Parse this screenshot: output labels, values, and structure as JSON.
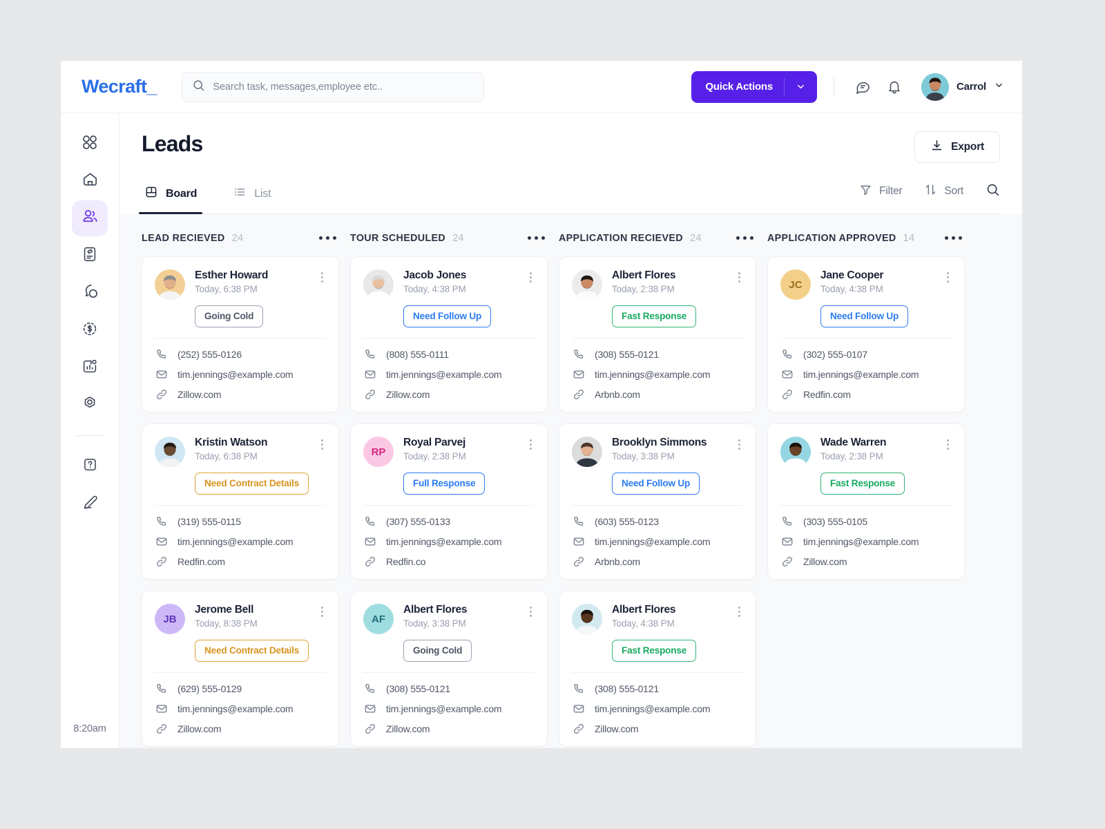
{
  "header": {
    "logo": "Wecraft",
    "logo_tail": "_",
    "search": {
      "placeholder": "Search task, messages,employee etc.."
    },
    "quick_actions_label": "Quick Actions",
    "user_name": "Carrol",
    "accent_color": "#5720e8"
  },
  "sidebar": {
    "items": [
      {
        "name": "grid-icon"
      },
      {
        "name": "home-icon"
      },
      {
        "name": "people-icon"
      },
      {
        "name": "document-icon"
      },
      {
        "name": "chat-icon"
      },
      {
        "name": "dollar-icon"
      },
      {
        "name": "analytics-icon"
      },
      {
        "name": "target-icon"
      },
      {
        "name": "help-icon"
      },
      {
        "name": "edit-icon"
      }
    ],
    "clock": "8:20am"
  },
  "page": {
    "title": "Leads",
    "export_label": "Export",
    "tabs": [
      {
        "label": "Board",
        "active": true
      },
      {
        "label": "List",
        "active": false
      }
    ],
    "tools": [
      {
        "label": "Filter"
      },
      {
        "label": "Sort"
      },
      {
        "label": ""
      }
    ]
  },
  "badge_styles": {
    "Going Cold": {
      "color": "#4f5665",
      "border": "#9aa2b1"
    },
    "Need Follow Up": {
      "color": "#2b7cf0",
      "border": "#2b7cf0"
    },
    "Full Response": {
      "color": "#2b7cf0",
      "border": "#2b7cf0"
    },
    "Need Contract Details": {
      "color": "#d99420",
      "border": "#e0a336"
    },
    "Fast Response": {
      "color": "#17a963",
      "border": "#2eb472"
    }
  },
  "columns": [
    {
      "title": "LEAD RECIEVED",
      "count": "24",
      "cards": [
        {
          "name": "Esther Howard",
          "time": "Today, 6:38 PM",
          "badge": "Going Cold",
          "phone": "(252) 555-0126",
          "email": "tim.jennings@example.com",
          "site": "Zillow.com",
          "avatar": {
            "type": "photo",
            "bg": "#f3cf96",
            "skin": "#e0b08a",
            "hair": "#8d8d8d",
            "shirt": "#f4f4f4"
          }
        },
        {
          "name": "Kristin Watson",
          "time": "Today, 6:38 PM",
          "badge": "Need Contract Details",
          "phone": "(319) 555-0115",
          "email": "tim.jennings@example.com",
          "site": "Redfin.com",
          "avatar": {
            "type": "photo",
            "bg": "#cfe7f2",
            "skin": "#6b4a33",
            "hair": "#241a14",
            "shirt": "#f0f2f4"
          }
        },
        {
          "name": "Jerome Bell",
          "time": "Today, 8:38 PM",
          "badge": "Need Contract Details",
          "phone": "(629) 555-0129",
          "email": "tim.jennings@example.com",
          "site": "Zillow.com",
          "avatar": {
            "type": "initials",
            "initials": "JB",
            "bg": "#cdb8f7",
            "fg": "#5e36b8"
          }
        }
      ]
    },
    {
      "title": "TOUR SCHEDULED",
      "count": "24",
      "cards": [
        {
          "name": "Jacob Jones",
          "time": "Today, 4:38 PM",
          "badge": "Need Follow Up",
          "phone": "(808) 555-0111",
          "email": "tim.jennings@example.com",
          "site": "Zillow.com",
          "avatar": {
            "type": "photo",
            "bg": "#e8e8e8",
            "skin": "#e8c1a2",
            "hair": "#d8d8d8",
            "shirt": "#ffffff"
          }
        },
        {
          "name": "Royal Parvej",
          "time": "Today, 2:38 PM",
          "badge": "Full Response",
          "phone": "(307) 555-0133",
          "email": "tim.jennings@example.com",
          "site": "Redfin.co",
          "avatar": {
            "type": "initials",
            "initials": "RP",
            "bg": "#fbc8e4",
            "fg": "#d6277f"
          }
        },
        {
          "name": "Albert Flores",
          "time": "Today, 3:38 PM",
          "badge": "Going Cold",
          "phone": "(308) 555-0121",
          "email": "tim.jennings@example.com",
          "site": "Zillow.com",
          "avatar": {
            "type": "initials",
            "initials": "AF",
            "bg": "#9fdde0",
            "fg": "#1f6f79"
          }
        }
      ]
    },
    {
      "title": "APPLICATION RECIEVED",
      "count": "24",
      "cards": [
        {
          "name": "Albert Flores",
          "time": "Today, 2:38 PM",
          "badge": "Fast Response",
          "phone": "(308) 555-0121",
          "email": "tim.jennings@example.com",
          "site": "Arbnb.com",
          "avatar": {
            "type": "photo",
            "bg": "#ececec",
            "skin": "#c98a63",
            "hair": "#221711",
            "shirt": "#fbfbfb"
          }
        },
        {
          "name": "Brooklyn Simmons",
          "time": "Today, 3:38 PM",
          "badge": "Need Follow Up",
          "phone": "(603) 555-0123",
          "email": "tim.jennings@example.com",
          "site": "Arbnb.com",
          "avatar": {
            "type": "photo",
            "bg": "#dcdcdc",
            "skin": "#e2b293",
            "hair": "#4a3728",
            "shirt": "#2e3742"
          }
        },
        {
          "name": "Albert Flores",
          "time": "Today, 4:38 PM",
          "badge": "Fast Response",
          "phone": "(308) 555-0121",
          "email": "tim.jennings@example.com",
          "site": "Zillow.com",
          "avatar": {
            "type": "photo",
            "bg": "#d3e9f0",
            "skin": "#58351f",
            "hair": "#1a120c",
            "shirt": "#f4f6f7"
          }
        }
      ]
    },
    {
      "title": "APPLICATION APPROVED",
      "count": "14",
      "cards": [
        {
          "name": "Jane Cooper",
          "time": "Today, 4:38 PM",
          "badge": "Need Follow Up",
          "phone": "(302) 555-0107",
          "email": "tim.jennings@example.com",
          "site": "Redfin.com",
          "avatar": {
            "type": "initials",
            "initials": "JC",
            "bg": "#f2d08a",
            "fg": "#9a6f1e"
          }
        },
        {
          "name": "Wade Warren",
          "time": "Today, 2:38 PM",
          "badge": "Fast Response",
          "phone": "(303) 555-0105",
          "email": "tim.jennings@example.com",
          "site": "Zillow.com",
          "avatar": {
            "type": "photo",
            "bg": "#95d6e3",
            "skin": "#6a4227",
            "hair": "#1b120b",
            "shirt": "#ffffff"
          }
        }
      ]
    }
  ]
}
